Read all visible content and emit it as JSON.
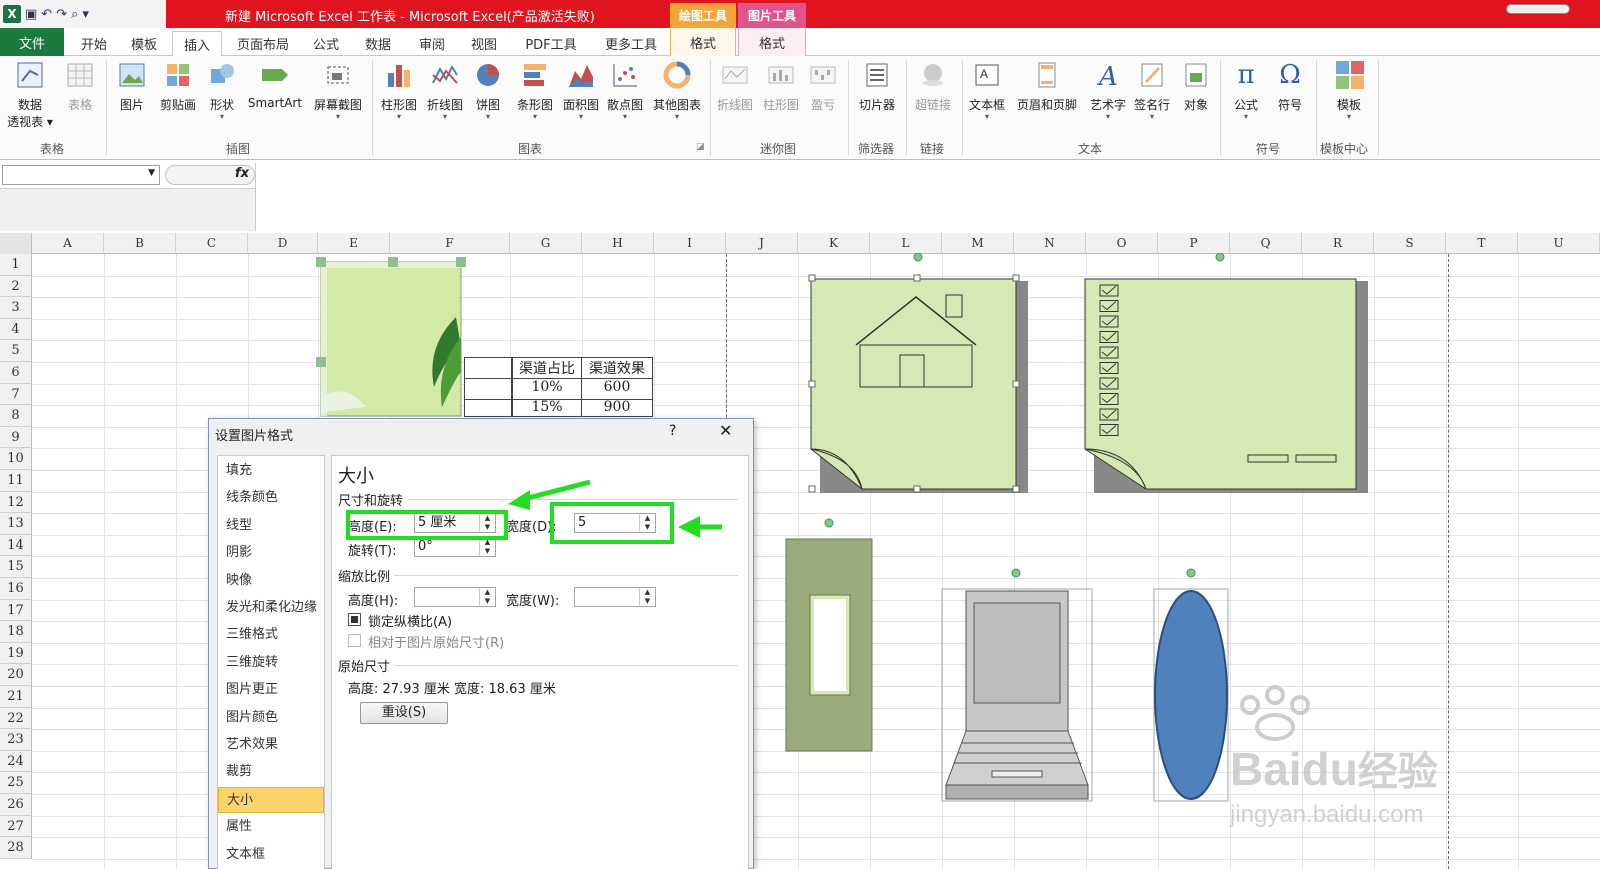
{
  "window": {
    "title": "新建 Microsoft Excel 工作表 - Microsoft Excel(产品激活失败)",
    "context_tabs": [
      "绘图工具",
      "图片工具"
    ],
    "app_icon": "excel-icon"
  },
  "tabs": {
    "file": "文件",
    "items": [
      "开始",
      "模板",
      "插入",
      "页面布局",
      "公式",
      "数据",
      "审阅",
      "视图",
      "PDF工具",
      "更多工具"
    ],
    "context_sub": [
      "格式",
      "格式"
    ],
    "active": "插入"
  },
  "ribbon": {
    "buttons": [
      {
        "label": "数据",
        "label2": "透视表 ▾",
        "icon": "pivot-table-icon"
      },
      {
        "label": "表格",
        "icon": "table-icon",
        "disabled": true
      },
      {
        "label": "图片",
        "icon": "picture-icon"
      },
      {
        "label": "剪贴画",
        "icon": "clipart-icon"
      },
      {
        "label": "形状",
        "icon": "shapes-icon"
      },
      {
        "label": "SmartArt",
        "icon": "smartart-icon"
      },
      {
        "label": "屏幕截图",
        "icon": "screenshot-icon"
      },
      {
        "label": "柱形图",
        "icon": "column-chart-icon"
      },
      {
        "label": "折线图",
        "icon": "line-chart-icon"
      },
      {
        "label": "饼图",
        "icon": "pie-chart-icon"
      },
      {
        "label": "条形图",
        "icon": "bar-chart-icon"
      },
      {
        "label": "面积图",
        "icon": "area-chart-icon"
      },
      {
        "label": "散点图",
        "icon": "scatter-chart-icon"
      },
      {
        "label": "其他图表",
        "icon": "other-charts-icon"
      },
      {
        "label": "折线图",
        "icon": "sparkline-line-icon",
        "disabled": true
      },
      {
        "label": "柱形图",
        "icon": "sparkline-column-icon",
        "disabled": true
      },
      {
        "label": "盈亏",
        "icon": "sparkline-winloss-icon",
        "disabled": true
      },
      {
        "label": "切片器",
        "icon": "slicer-icon"
      },
      {
        "label": "超链接",
        "icon": "hyperlink-icon",
        "disabled": true
      },
      {
        "label": "文本框",
        "icon": "textbox-icon"
      },
      {
        "label": "页眉和页脚",
        "icon": "header-footer-icon"
      },
      {
        "label": "艺术字",
        "icon": "wordart-icon"
      },
      {
        "label": "签名行",
        "icon": "signature-line-icon"
      },
      {
        "label": "对象",
        "icon": "object-icon"
      },
      {
        "label": "公式",
        "icon": "equation-icon"
      },
      {
        "label": "符号",
        "icon": "symbol-icon"
      },
      {
        "label": "模板",
        "icon": "template-icon"
      }
    ],
    "groups": [
      "表格",
      "插图",
      "图表",
      "迷你图",
      "筛选器",
      "链接",
      "文本",
      "符号",
      "模板中心"
    ]
  },
  "formula_bar": {
    "fx": "fx",
    "name_box": "",
    "formula": ""
  },
  "grid": {
    "columns": [
      "A",
      "B",
      "C",
      "D",
      "E",
      "F",
      "G",
      "H",
      "I",
      "J",
      "K",
      "L",
      "M",
      "N",
      "O",
      "P",
      "Q",
      "R",
      "S",
      "T",
      "U"
    ],
    "rows": [
      "1",
      "2",
      "3",
      "4",
      "5",
      "6",
      "7",
      "8",
      "9",
      "10",
      "11",
      "12",
      "13",
      "14",
      "15",
      "16",
      "17",
      "18",
      "19",
      "20",
      "21",
      "22",
      "23",
      "24",
      "25",
      "26",
      "27",
      "28"
    ],
    "table": {
      "headers": [
        "渠道占比",
        "渠道效果"
      ],
      "rows": [
        [
          "10%",
          "600"
        ],
        [
          "15%",
          "900"
        ]
      ]
    }
  },
  "dialog": {
    "title": "设置图片格式",
    "help": "?",
    "close": "✕",
    "nav": [
      "填充",
      "线条颜色",
      "线型",
      "阴影",
      "映像",
      "发光和柔化边缘",
      "三维格式",
      "三维旋转",
      "图片更正",
      "图片颜色",
      "艺术效果",
      "裁剪",
      "大小",
      "属性",
      "文本框"
    ],
    "selected_nav": "大小",
    "panel": {
      "heading": "大小",
      "section_size": "尺寸和旋转",
      "height_label": "高度(E):",
      "height_value": "5 厘米",
      "width_label": "宽度(D):",
      "width_value": "5",
      "rotation_label": "旋转(T):",
      "rotation_value": "0°",
      "section_scale": "缩放比例",
      "scale_height_label": "高度(H):",
      "scale_width_label": "宽度(W):",
      "lock_ratio": "锁定纵横比(A)",
      "relative_original": "相对于图片原始尺寸(R)",
      "section_original": "原始尺寸",
      "original_size": "高度:  27.93 厘米   宽度:  18.63 厘米",
      "reset": "重设(S)"
    }
  },
  "watermark": {
    "brand": "Bai",
    "brand2": "du",
    "brand3": "经验",
    "url": "jingyan.baidu.com"
  },
  "colors": {
    "accent_green": "#22dd22",
    "title_red": "#e0141e",
    "shape_fill": "#d6e8b3",
    "oval_blue": "#4f81bd"
  }
}
